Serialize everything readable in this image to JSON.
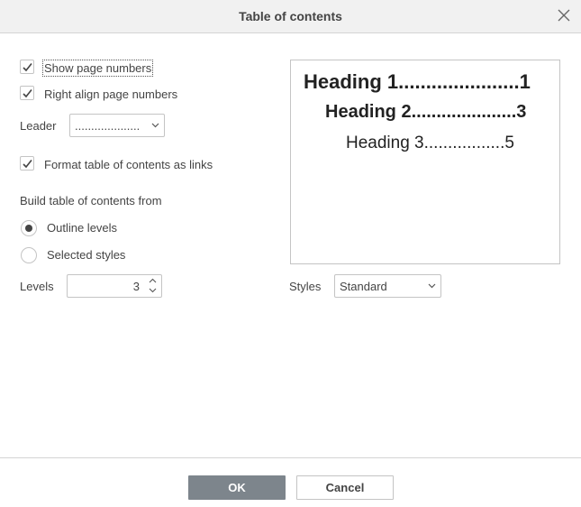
{
  "dialog": {
    "title": "Table of contents"
  },
  "options": {
    "show_page_numbers": {
      "label": "Show page numbers",
      "checked": true
    },
    "right_align": {
      "label": "Right align page numbers",
      "checked": true
    },
    "leader": {
      "label": "Leader",
      "value": "...................."
    },
    "format_links": {
      "label": "Format table of contents as links",
      "checked": true
    }
  },
  "build": {
    "heading": "Build table of contents from",
    "outline_levels": {
      "label": "Outline levels",
      "selected": true
    },
    "selected_styles": {
      "label": "Selected styles",
      "selected": false
    },
    "levels": {
      "label": "Levels",
      "value": "3"
    }
  },
  "preview": {
    "lines": [
      {
        "text": "Heading 1......................1"
      },
      {
        "text": "Heading 2.....................3"
      },
      {
        "text": "Heading 3.................5"
      }
    ]
  },
  "styles": {
    "label": "Styles",
    "value": "Standard"
  },
  "footer": {
    "ok_label": "OK",
    "cancel_label": "Cancel"
  },
  "colors": {
    "ok_button_bg": "#7d858c",
    "titlebar_bg": "#f1f1f1",
    "border": "#c4c4c4"
  }
}
